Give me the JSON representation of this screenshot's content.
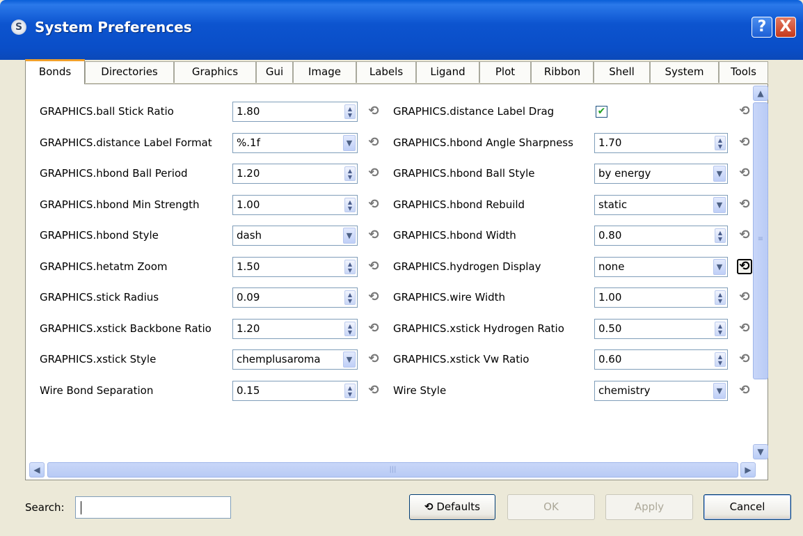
{
  "window": {
    "title": "System Preferences",
    "help_label": "?",
    "close_label": "X"
  },
  "tabs": [
    "Bonds",
    "Directories",
    "Graphics",
    "Gui",
    "Image",
    "Labels",
    "Ligand",
    "Plot",
    "Ribbon",
    "Shell",
    "System",
    "Tools"
  ],
  "active_tab": "Bonds",
  "settings_left": [
    {
      "label": "GRAPHICS.ball Stick Ratio",
      "value": "1.80",
      "control": "spinner"
    },
    {
      "label": "GRAPHICS.distance Label Format",
      "value": "%.1f",
      "control": "dropdown"
    },
    {
      "label": "GRAPHICS.hbond Ball Period",
      "value": "1.20",
      "control": "spinner"
    },
    {
      "label": "GRAPHICS.hbond Min Strength",
      "value": "1.00",
      "control": "spinner"
    },
    {
      "label": "GRAPHICS.hbond Style",
      "value": "dash",
      "control": "dropdown"
    },
    {
      "label": "GRAPHICS.hetatm Zoom",
      "value": "1.50",
      "control": "spinner"
    },
    {
      "label": "GRAPHICS.stick Radius",
      "value": "0.09",
      "control": "spinner"
    },
    {
      "label": "GRAPHICS.xstick Backbone Ratio",
      "value": "1.20",
      "control": "spinner"
    },
    {
      "label": "GRAPHICS.xstick Style",
      "value": "chemplusaroma",
      "control": "dropdown"
    },
    {
      "label": "Wire Bond Separation",
      "value": "0.15",
      "control": "spinner"
    }
  ],
  "settings_right": [
    {
      "label": "GRAPHICS.distance Label Drag",
      "value": "",
      "control": "checkbox",
      "checked": true
    },
    {
      "label": "GRAPHICS.hbond Angle Sharpness",
      "value": "1.70",
      "control": "spinner"
    },
    {
      "label": "GRAPHICS.hbond Ball Style",
      "value": "by energy",
      "control": "dropdown"
    },
    {
      "label": "GRAPHICS.hbond Rebuild",
      "value": "static",
      "control": "dropdown"
    },
    {
      "label": "GRAPHICS.hbond Width",
      "value": "0.80",
      "control": "spinner"
    },
    {
      "label": "GRAPHICS.hydrogen Display",
      "value": "none",
      "control": "dropdown"
    },
    {
      "label": "GRAPHICS.wire Width",
      "value": "1.00",
      "control": "spinner"
    },
    {
      "label": "GRAPHICS.xstick Hydrogen Ratio",
      "value": "0.50",
      "control": "spinner"
    },
    {
      "label": "GRAPHICS.xstick Vw Ratio",
      "value": "0.60",
      "control": "spinner"
    },
    {
      "label": "Wire Style",
      "value": "chemistry",
      "control": "dropdown"
    }
  ],
  "icons": {
    "reset": "reset-arrow-icon",
    "spinner": "spinner-arrows-icon",
    "dropdown": "chevron-down-icon"
  },
  "footer": {
    "search_label": "Search:",
    "search_value": "",
    "defaults_label": "Defaults",
    "ok_label": "OK",
    "apply_label": "Apply",
    "cancel_label": "Cancel"
  },
  "colors": {
    "titlebar": "#0a4ec8",
    "active_tab_accent": "#f0a02c",
    "window_bg": "#ece9d8"
  }
}
